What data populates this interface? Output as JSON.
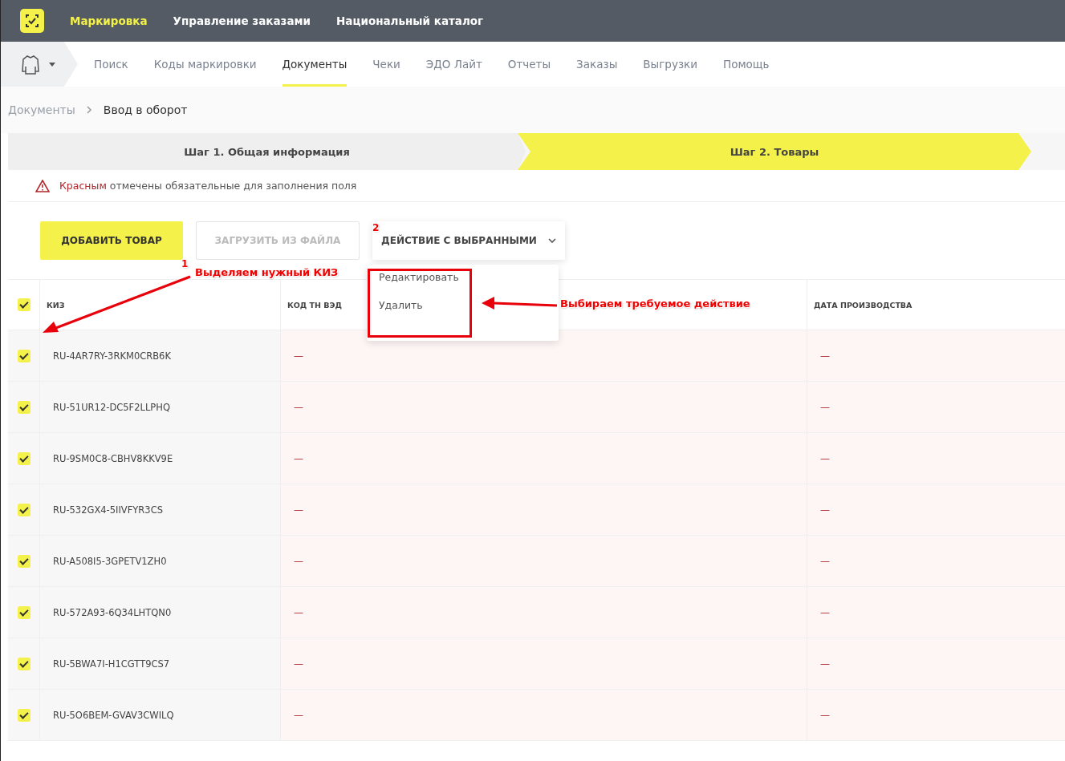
{
  "top_nav": [
    {
      "label": "Маркировка",
      "selected": true
    },
    {
      "label": "Управление заказами",
      "selected": false
    },
    {
      "label": "Национальный каталог",
      "selected": false
    }
  ],
  "sub_nav": [
    {
      "label": "Поиск",
      "selected": false
    },
    {
      "label": "Коды маркировки",
      "selected": false
    },
    {
      "label": "Документы",
      "selected": true
    },
    {
      "label": "Чеки",
      "selected": false
    },
    {
      "label": "ЭДО Лайт",
      "selected": false
    },
    {
      "label": "Отчеты",
      "selected": false
    },
    {
      "label": "Заказы",
      "selected": false
    },
    {
      "label": "Выгрузки",
      "selected": false
    },
    {
      "label": "Помощь",
      "selected": false
    }
  ],
  "breadcrumb": [
    "Документы",
    "Ввод в оборот"
  ],
  "steps": [
    {
      "label": "Шаг 1. Общая информация",
      "selected": false
    },
    {
      "label": "Шаг 2. Товары",
      "selected": true
    }
  ],
  "notice": "**Красным** отмечены обязательные для заполнения поля",
  "buttons": [
    {
      "label": "ДОБАВИТЬ ТОВАР",
      "kind": "primary"
    },
    {
      "label": "ЗАГРУЗИТЬ ИЗ ФАЙЛА",
      "kind": "disabled"
    },
    {
      "label": "ДЕЙСТВИЕ С ВЫБРАННЫМИ",
      "kind": "dropdown"
    }
  ],
  "dropdown_menu": [
    "Редактировать",
    "Удалить"
  ],
  "table": {
    "select_all": {
      "checked": true
    },
    "columns": [
      "КИЗ",
      "КОД ТН ВЭД",
      "ДАТА ПРОИЗВОДСТВА"
    ],
    "rows": [
      {
        "checked": true,
        "cells": [
          "RU-4AR7RY-3RKM0CRB6K",
          "—",
          "—"
        ]
      },
      {
        "checked": true,
        "cells": [
          "RU-51UR12-DC5F2LLPHQ",
          "—",
          "—"
        ]
      },
      {
        "checked": true,
        "cells": [
          "RU-9SM0C8-CBHV8KKV9E",
          "—",
          "—"
        ]
      },
      {
        "checked": true,
        "cells": [
          "RU-532GX4-5IIVFYR3CS",
          "—",
          "—"
        ]
      },
      {
        "checked": true,
        "cells": [
          "RU-A508I5-3GPETV1ZH0",
          "—",
          "—"
        ]
      },
      {
        "checked": true,
        "cells": [
          "RU-572A93-6Q34LHTQN0",
          "—",
          "—"
        ]
      },
      {
        "checked": true,
        "cells": [
          "RU-5BWA7I-H1CGTT9CS7",
          "—",
          "—"
        ]
      },
      {
        "checked": true,
        "cells": [
          "RU-5O6BEM-GVAV3CWILQ",
          "—",
          "—"
        ]
      }
    ]
  },
  "annotations": [
    {
      "number": "1",
      "text": "Выделяем нужный КИЗ"
    },
    {
      "number": "2"
    },
    {
      "text": "Выбираем требуемое действие"
    }
  ]
}
